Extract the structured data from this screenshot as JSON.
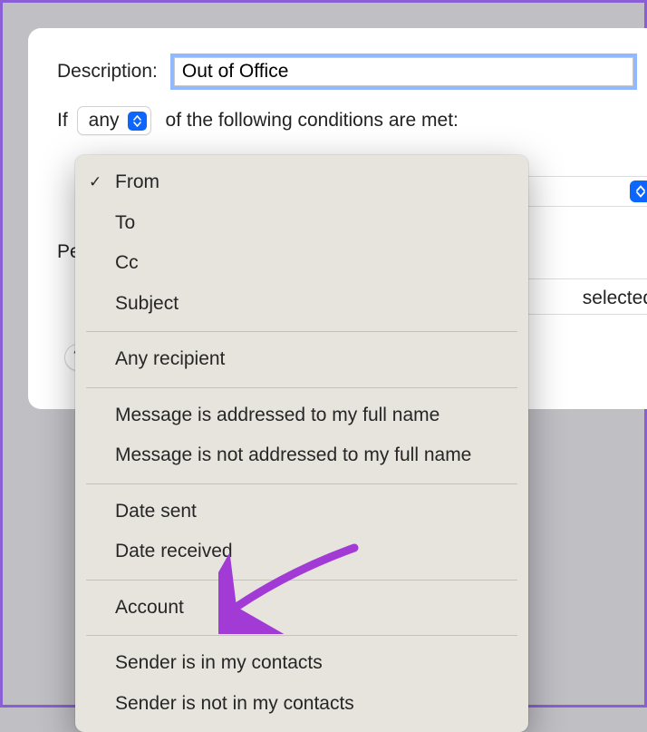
{
  "labels": {
    "description": "Description:",
    "if_prefix": "If",
    "if_suffix": "of the following conditions are met:",
    "scope": "any",
    "perform_truncated": "Pe",
    "selected_fragment": "selected",
    "help": "?"
  },
  "description_value": "Out of Office",
  "menu": {
    "selected_index": 0,
    "groups": [
      [
        "From",
        "To",
        "Cc",
        "Subject"
      ],
      [
        "Any recipient"
      ],
      [
        "Message is addressed to my full name",
        "Message is not addressed to my full name"
      ],
      [
        "Date sent",
        "Date received"
      ],
      [
        "Account"
      ],
      [
        "Sender is in my contacts",
        "Sender is not in my contacts"
      ]
    ]
  }
}
